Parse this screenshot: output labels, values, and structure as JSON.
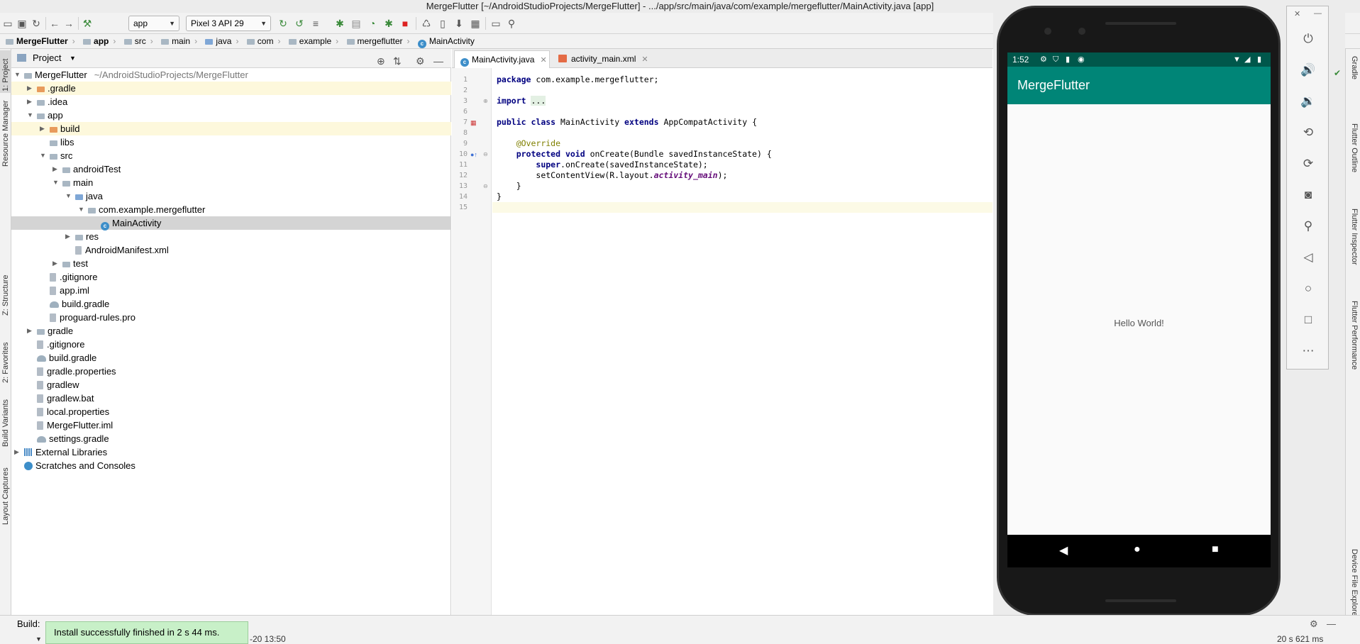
{
  "window": {
    "title": "MergeFlutter [~/AndroidStudioProjects/MergeFlutter] - .../app/src/main/java/com/example/mergeflutter/MainActivity.java [app]"
  },
  "toolbar": {
    "run_config": "app",
    "device": "Pixel 3 API 29"
  },
  "breadcrumb": [
    "MergeFlutter",
    "app",
    "src",
    "main",
    "java",
    "com",
    "example",
    "mergeflutter",
    "MainActivity"
  ],
  "left_tabs": [
    "1: Project",
    "Resource Manager",
    "Z: Structure",
    "2: Favorites",
    "Build Variants",
    "Layout Captures"
  ],
  "right_tabs": [
    "Gradle",
    "Flutter Outline",
    "Flutter Inspector",
    "Flutter Performance",
    "Device File Explorer"
  ],
  "project": {
    "view_label": "Project",
    "tree": [
      {
        "label": "MergeFlutter",
        "path": "~/AndroidStudioProjects/MergeFlutter",
        "depth": 0,
        "icon": "folder",
        "arrow": "open"
      },
      {
        "label": ".gradle",
        "depth": 1,
        "icon": "folder-orange",
        "arrow": "closed",
        "state": "highlight"
      },
      {
        "label": ".idea",
        "depth": 1,
        "icon": "folder",
        "arrow": "closed"
      },
      {
        "label": "app",
        "depth": 1,
        "icon": "folder",
        "arrow": "open"
      },
      {
        "label": "build",
        "depth": 2,
        "icon": "folder-orange",
        "arrow": "closed",
        "state": "highlight"
      },
      {
        "label": "libs",
        "depth": 2,
        "icon": "folder",
        "arrow": ""
      },
      {
        "label": "src",
        "depth": 2,
        "icon": "folder",
        "arrow": "open"
      },
      {
        "label": "androidTest",
        "depth": 3,
        "icon": "folder",
        "arrow": "closed"
      },
      {
        "label": "main",
        "depth": 3,
        "icon": "folder",
        "arrow": "open"
      },
      {
        "label": "java",
        "depth": 4,
        "icon": "folder-blue",
        "arrow": "open"
      },
      {
        "label": "com.example.mergeflutter",
        "depth": 5,
        "icon": "package",
        "arrow": "open"
      },
      {
        "label": "MainActivity",
        "depth": 6,
        "icon": "class",
        "arrow": "",
        "state": "selected"
      },
      {
        "label": "res",
        "depth": 4,
        "icon": "folder",
        "arrow": "closed"
      },
      {
        "label": "AndroidManifest.xml",
        "depth": 4,
        "icon": "file",
        "arrow": ""
      },
      {
        "label": "test",
        "depth": 3,
        "icon": "folder",
        "arrow": "closed"
      },
      {
        "label": ".gitignore",
        "depth": 2,
        "icon": "file",
        "arrow": ""
      },
      {
        "label": "app.iml",
        "depth": 2,
        "icon": "file",
        "arrow": ""
      },
      {
        "label": "build.gradle",
        "depth": 2,
        "icon": "gradle",
        "arrow": ""
      },
      {
        "label": "proguard-rules.pro",
        "depth": 2,
        "icon": "file",
        "arrow": ""
      },
      {
        "label": "gradle",
        "depth": 1,
        "icon": "folder",
        "arrow": "closed"
      },
      {
        "label": ".gitignore",
        "depth": 1,
        "icon": "file",
        "arrow": ""
      },
      {
        "label": "build.gradle",
        "depth": 1,
        "icon": "gradle",
        "arrow": ""
      },
      {
        "label": "gradle.properties",
        "depth": 1,
        "icon": "file",
        "arrow": ""
      },
      {
        "label": "gradlew",
        "depth": 1,
        "icon": "file",
        "arrow": ""
      },
      {
        "label": "gradlew.bat",
        "depth": 1,
        "icon": "file",
        "arrow": ""
      },
      {
        "label": "local.properties",
        "depth": 1,
        "icon": "file",
        "arrow": ""
      },
      {
        "label": "MergeFlutter.iml",
        "depth": 1,
        "icon": "file",
        "arrow": ""
      },
      {
        "label": "settings.gradle",
        "depth": 1,
        "icon": "gradle",
        "arrow": ""
      },
      {
        "label": "External Libraries",
        "depth": 0,
        "icon": "library",
        "arrow": "closed"
      },
      {
        "label": "Scratches and Consoles",
        "depth": 0,
        "icon": "scratch",
        "arrow": ""
      }
    ]
  },
  "editor": {
    "tabs": [
      {
        "label": "MainActivity.java",
        "active": true
      },
      {
        "label": "activity_main.xml",
        "active": false
      }
    ],
    "line_numbers": [
      "1",
      "2",
      "3",
      "6",
      "7",
      "8",
      "9",
      "10",
      "11",
      "12",
      "13",
      "14",
      "15"
    ],
    "code": {
      "pkg_kw": "package",
      "pkg_name": " com.example.mergeflutter;",
      "import_kw": "import",
      "import_fold": "...",
      "class_pub": "public",
      "class_kw": "class",
      "class_name": " MainActivity ",
      "extends_kw": "extends",
      "super_class": " AppCompatActivity {",
      "annotation": "@Override",
      "method_prot": "protected",
      "method_void": "void",
      "method_sig": " onCreate(Bundle savedInstanceState) {",
      "super_kw": "super",
      "super_call": ".onCreate(savedInstanceState);",
      "set_content": "setContentView(R.layout.",
      "layout_id": "activity_main",
      "set_content_end": ");",
      "close_method": "}",
      "close_class": "}"
    }
  },
  "emulator": {
    "status_time": "1:52",
    "app_title": "MergeFlutter",
    "body_text": "Hello World!",
    "side_buttons": [
      "power-icon",
      "volume-up-icon",
      "volume-down-icon",
      "rotate-left-icon",
      "rotate-right-icon",
      "camera-icon",
      "zoom-icon",
      "back-icon",
      "home-icon",
      "overview-icon",
      "more-icon"
    ]
  },
  "bottom": {
    "build_label": "Build:",
    "toast": "Install successfully finished in 2 s 44 ms.",
    "status_left": "-20 13:50",
    "status_right": "20 s 621 ms"
  },
  "colors": {
    "app_bar": "#008577",
    "status_bar": "#00574b",
    "toast_bg": "#c8f0c8",
    "selected_row": "#d4d4d4"
  }
}
